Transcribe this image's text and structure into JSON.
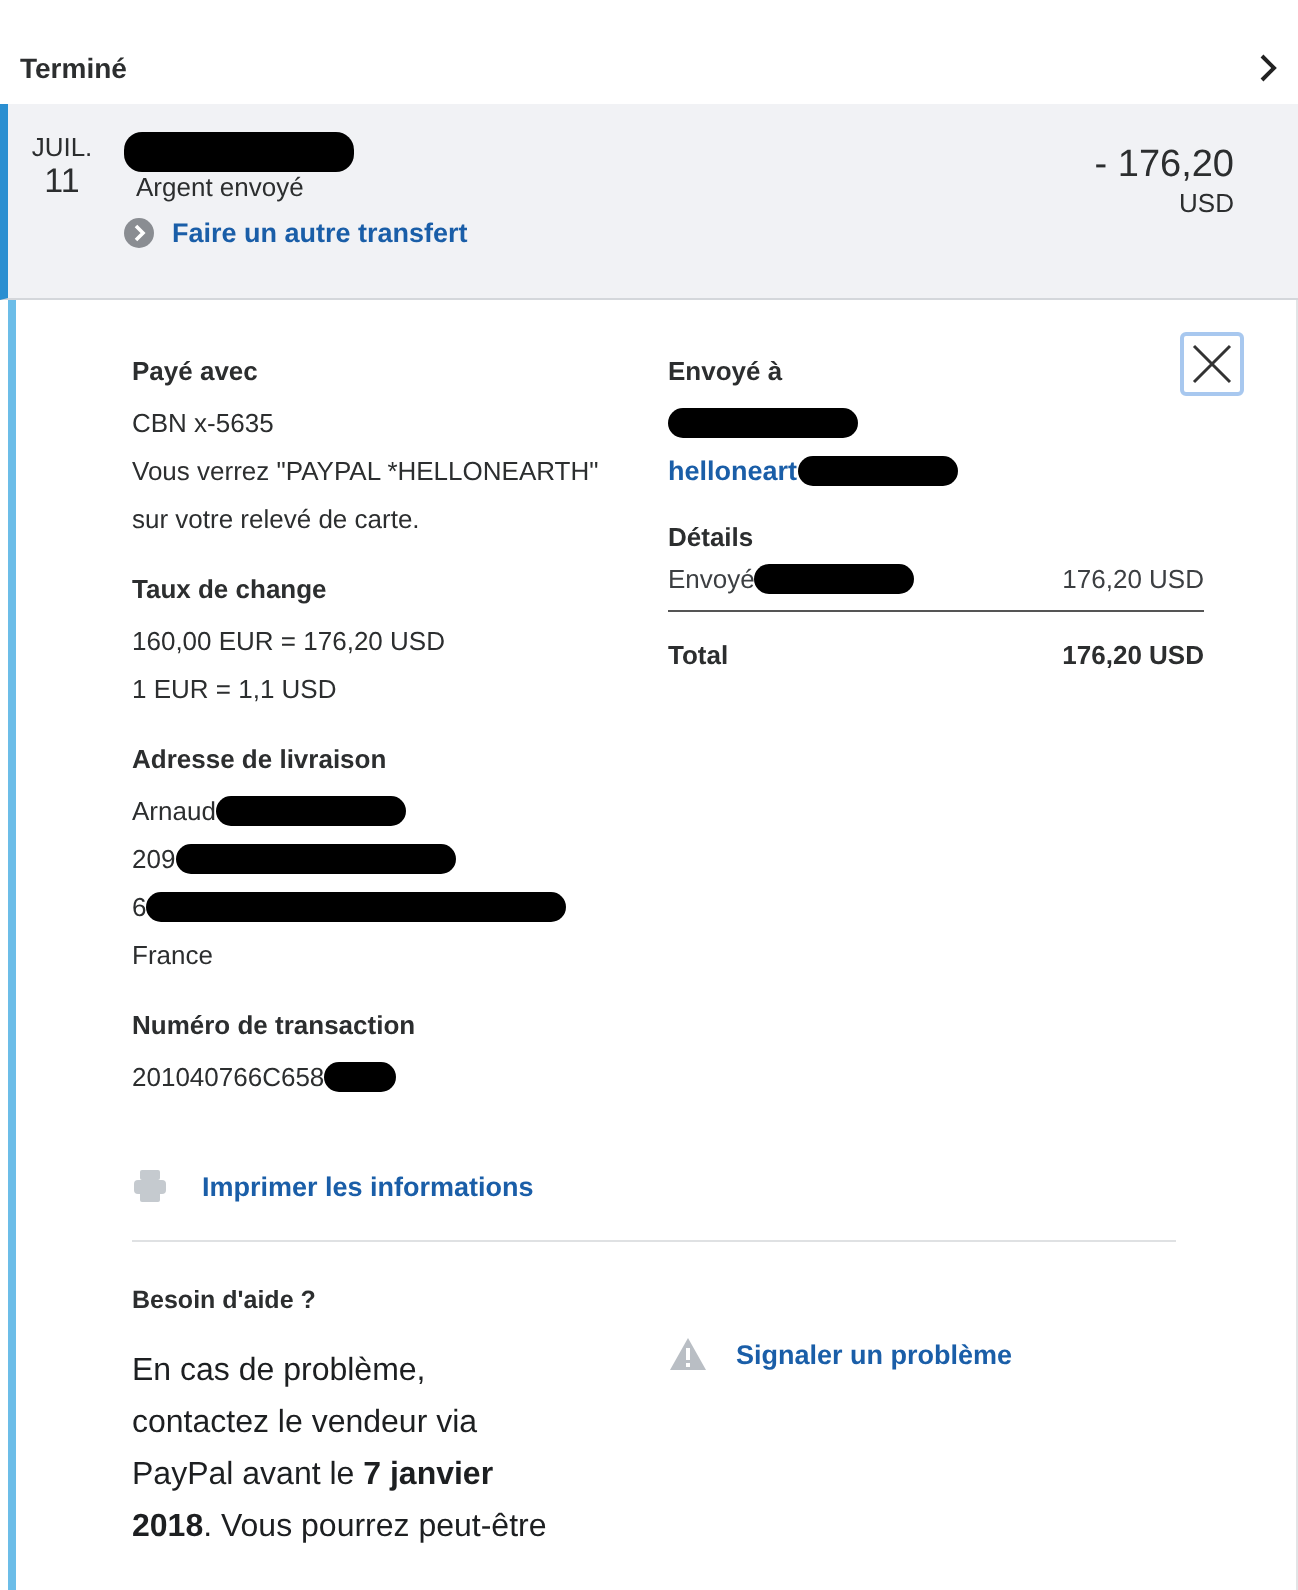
{
  "header": {
    "title": "Terminé"
  },
  "transaction": {
    "month": "JUIL.",
    "day": "11",
    "recipient_redacted": true,
    "type": "Argent envoyé",
    "amount": "- 176,20",
    "currency": "USD",
    "expanded": true,
    "action": "Faire un autre transfert"
  },
  "left": [
    {
      "heading": "Payé avec",
      "lines": [
        {
          "text": "CBN x-5635",
          "redacted": false
        },
        {
          "text": "Vous verrez \"PAYPAL *HELLONEARTH\"",
          "redacted": false
        },
        {
          "text": "sur votre relevé de carte.",
          "redacted": false
        }
      ]
    },
    {
      "heading": "Taux de change",
      "lines": [
        {
          "text": "160,00 EUR = 176,20 USD",
          "redacted": false
        },
        {
          "text": "1 EUR = 1,1 USD",
          "redacted": false
        }
      ]
    },
    {
      "heading": "Adresse de livraison",
      "lines": [
        {
          "text": "Arnaud",
          "redacted": true
        },
        {
          "text": "209",
          "redacted": true
        },
        {
          "text": "6",
          "redacted": true
        },
        {
          "text": "France",
          "redacted": false
        }
      ]
    },
    {
      "heading": "Numéro de transaction",
      "lines": [
        {
          "text": "201040766C658",
          "redacted": true
        }
      ]
    }
  ],
  "sent_to": {
    "heading": "Envoyé à",
    "name_redacted": true,
    "email": "helloneart",
    "email_redacted": true
  },
  "details": {
    "heading": "Détails",
    "rows": [
      {
        "label": "Envoyé",
        "redacted": true,
        "value": "176,20 USD"
      }
    ],
    "total_label": "Total",
    "total_value": "176,20 USD"
  },
  "print_link": "Imprimer les informations",
  "help": {
    "heading": "Besoin d'aide ?",
    "text": "En cas de problème,\ncontactez le vendeur via\nPayPal avant le **7 janvier\n2018**. Vous pourrez peut-être",
    "report_link": "Signaler un problème"
  }
}
